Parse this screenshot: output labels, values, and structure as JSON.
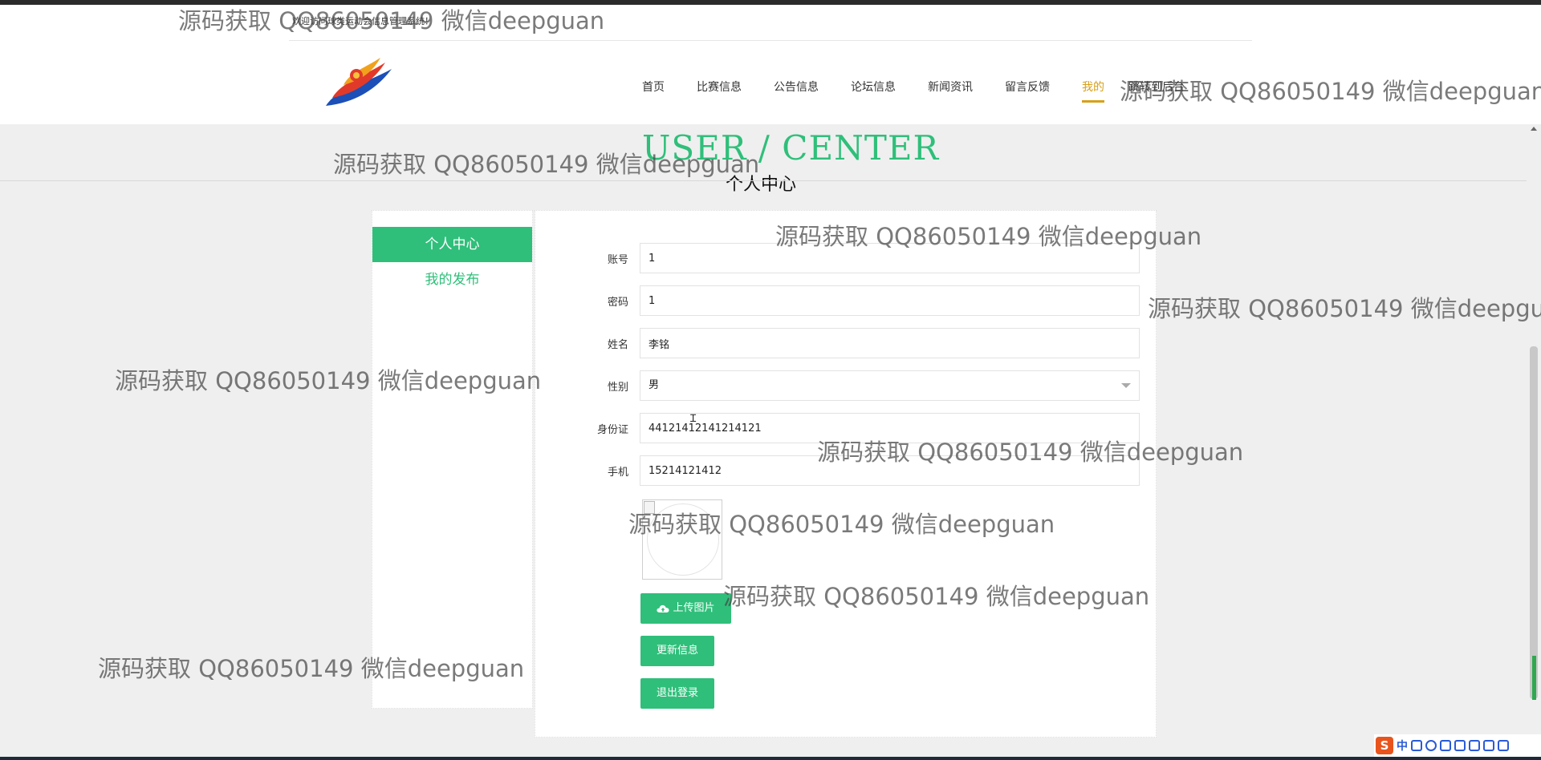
{
  "header": {
    "welcome": "欢迎访问球类运动会信息管理系统！"
  },
  "nav": {
    "items": [
      {
        "label": "首页"
      },
      {
        "label": "比赛信息"
      },
      {
        "label": "公告信息"
      },
      {
        "label": "论坛信息"
      },
      {
        "label": "新闻资讯"
      },
      {
        "label": "留言反馈"
      },
      {
        "label": "我的",
        "active": true
      },
      {
        "label": "跳转到后台"
      }
    ]
  },
  "page": {
    "title_en": "USER / CENTER",
    "title_cn": "个人中心"
  },
  "sidebar": {
    "items": [
      {
        "label": "个人中心",
        "active": true
      },
      {
        "label": "我的发布"
      }
    ]
  },
  "form": {
    "fields": [
      {
        "label": "账号",
        "value": "1"
      },
      {
        "label": "密码",
        "value": "1"
      },
      {
        "label": "姓名",
        "value": "李铭"
      },
      {
        "label": "性别",
        "value": "男"
      },
      {
        "label": "身份证",
        "value": "44121412141214121"
      },
      {
        "label": "手机",
        "value": "15214121412"
      }
    ],
    "upload_label": "上传图片",
    "update_label": "更新信息",
    "logout_label": "退出登录"
  },
  "watermark": {
    "text": "源码获取 QQ86050149 微信deepguan"
  },
  "tray": {
    "ime_label": "中",
    "logo_letter": "S"
  },
  "colors": {
    "accent": "#2fbf7a",
    "nav_active": "#d7a01a",
    "background": "#efefef"
  }
}
